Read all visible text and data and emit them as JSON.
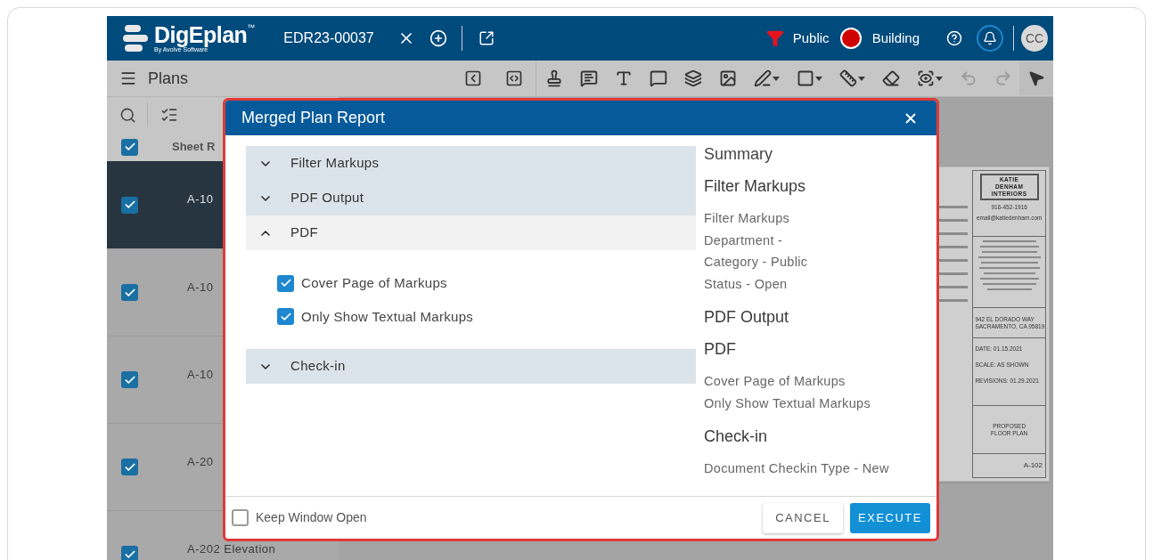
{
  "header": {
    "logo": "DigEplan",
    "trademark": "™",
    "byline": "By Avolve Software",
    "record": "EDR23-00037",
    "filter": "Public",
    "status": "Building",
    "avatar": "CC"
  },
  "toolbar": {
    "title": "Plans"
  },
  "sheet_list": {
    "header_label": "Sheet R",
    "header_checked": true,
    "rows": [
      {
        "label": "A-10",
        "checked": true,
        "selected": true
      },
      {
        "label": "A-10",
        "checked": true,
        "selected": false
      },
      {
        "label": "A-10",
        "checked": true,
        "selected": false
      },
      {
        "label": "A-20",
        "checked": true,
        "selected": false
      },
      {
        "label": "A-202 Elevation",
        "checked": true,
        "selected": false
      }
    ]
  },
  "modal": {
    "title": "Merged Plan Report",
    "sections": [
      {
        "title": "Filter Markups",
        "expanded": false
      },
      {
        "title": "PDF Output",
        "expanded": false
      },
      {
        "title": "PDF",
        "expanded": true,
        "options": [
          {
            "label": "Cover Page of Markups",
            "checked": true
          },
          {
            "label": "Only Show Textual Markups",
            "checked": true
          }
        ]
      },
      {
        "title": "Check-in",
        "expanded": false
      }
    ],
    "summary": [
      {
        "kind": "title",
        "text": "Summary"
      },
      {
        "kind": "heading",
        "text": "Filter Markups"
      },
      {
        "kind": "line",
        "text": "Filter Markups"
      },
      {
        "kind": "line",
        "text": "Department -"
      },
      {
        "kind": "line",
        "text": "Category - Public"
      },
      {
        "kind": "line",
        "text": "Status - Open"
      },
      {
        "kind": "heading",
        "text": "PDF Output"
      },
      {
        "kind": "heading",
        "text": "PDF"
      },
      {
        "kind": "line",
        "text": "Cover Page of Markups"
      },
      {
        "kind": "line",
        "text": "Only Show Textual Markups"
      },
      {
        "kind": "heading",
        "text": "Check-in"
      },
      {
        "kind": "line",
        "text": "Document Checkin Type - New"
      }
    ],
    "keep_open": {
      "label": "Keep Window Open",
      "checked": false
    },
    "buttons": [
      "CANCEL",
      "EXECUTE"
    ]
  },
  "sheet": {
    "company": [
      "KATIE",
      "DENHAM",
      "INTERIORS"
    ],
    "phone": "916-452-1916",
    "email": "email@katiedenham.com",
    "address": [
      "942 EL DORADO WAY",
      "SACRAMENTO, CA 95819"
    ],
    "date": "DATE: 01.15.2021",
    "scale": "SCALE: AS SHOWN",
    "revisions": "REVISIONS: 01.29.2021",
    "title": [
      "PROPOSED",
      "FLOOR PLAN"
    ],
    "number": "A-102"
  }
}
